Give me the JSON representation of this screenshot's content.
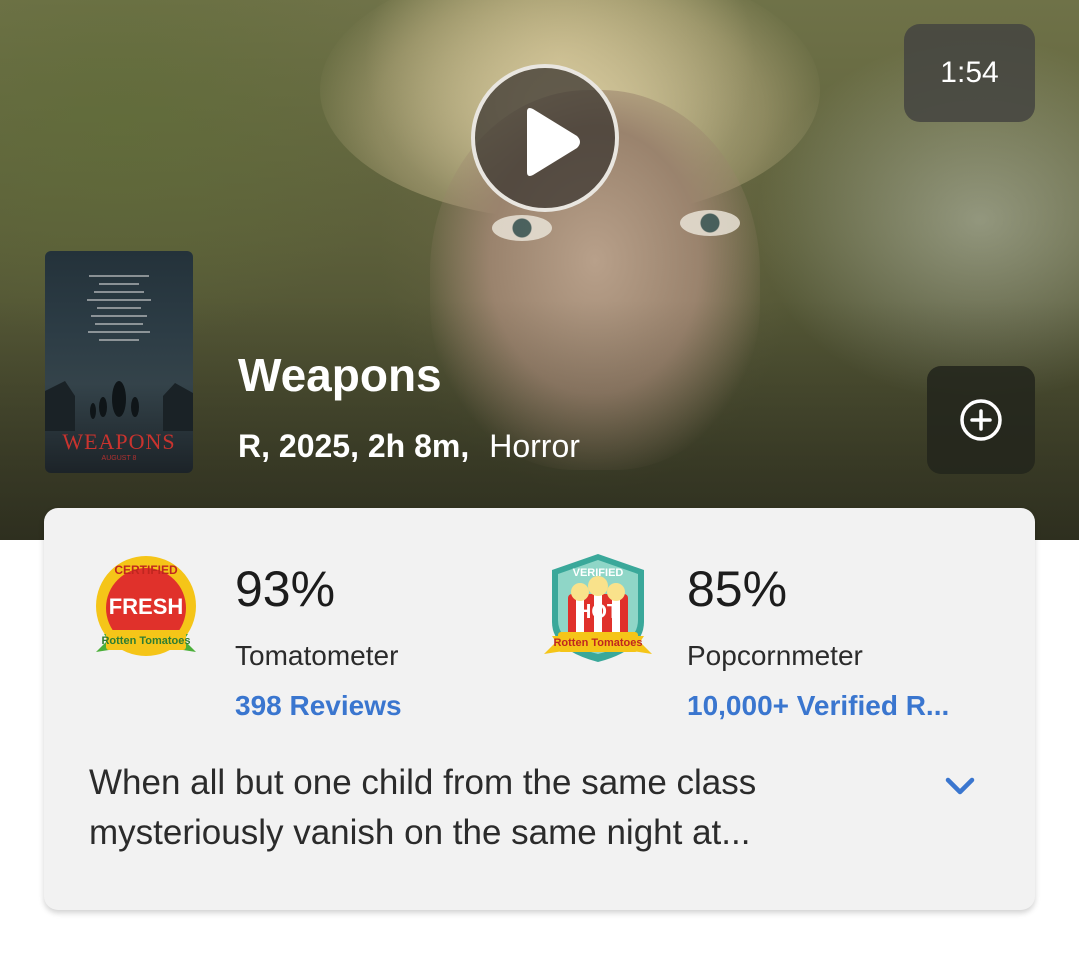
{
  "trailer": {
    "duration": "1:54"
  },
  "movie": {
    "title": "Weapons",
    "rating_year_runtime": "R, 2025, 2h 8m,",
    "genre": "Horror",
    "poster_title": "WEAPONS",
    "poster_subtitle": "AUGUST 8"
  },
  "scores": {
    "tomatometer": {
      "badge_top": "CERTIFIED",
      "badge_main": "FRESH",
      "badge_brand": "Rotten Tomatoes",
      "percent": "93%",
      "label": "Tomatometer",
      "reviews_link": "398 Reviews"
    },
    "popcornmeter": {
      "badge_top": "VERIFIED",
      "badge_main": "HOT",
      "badge_brand": "Rotten Tomatoes",
      "percent": "85%",
      "label": "Popcornmeter",
      "reviews_link": "10,000+ Verified R..."
    }
  },
  "synopsis": {
    "line1": "When all but one child from the same class",
    "line2": "mysteriously vanish on the same night at..."
  },
  "colors": {
    "link": "#3a76cf",
    "fresh_red": "#e0312b",
    "verified_teal": "#3aa89a",
    "badge_yellow": "#f5c518"
  },
  "icons": [
    "play-icon",
    "add-circle-icon",
    "certified-fresh-icon",
    "verified-hot-icon",
    "chevron-down-icon"
  ]
}
